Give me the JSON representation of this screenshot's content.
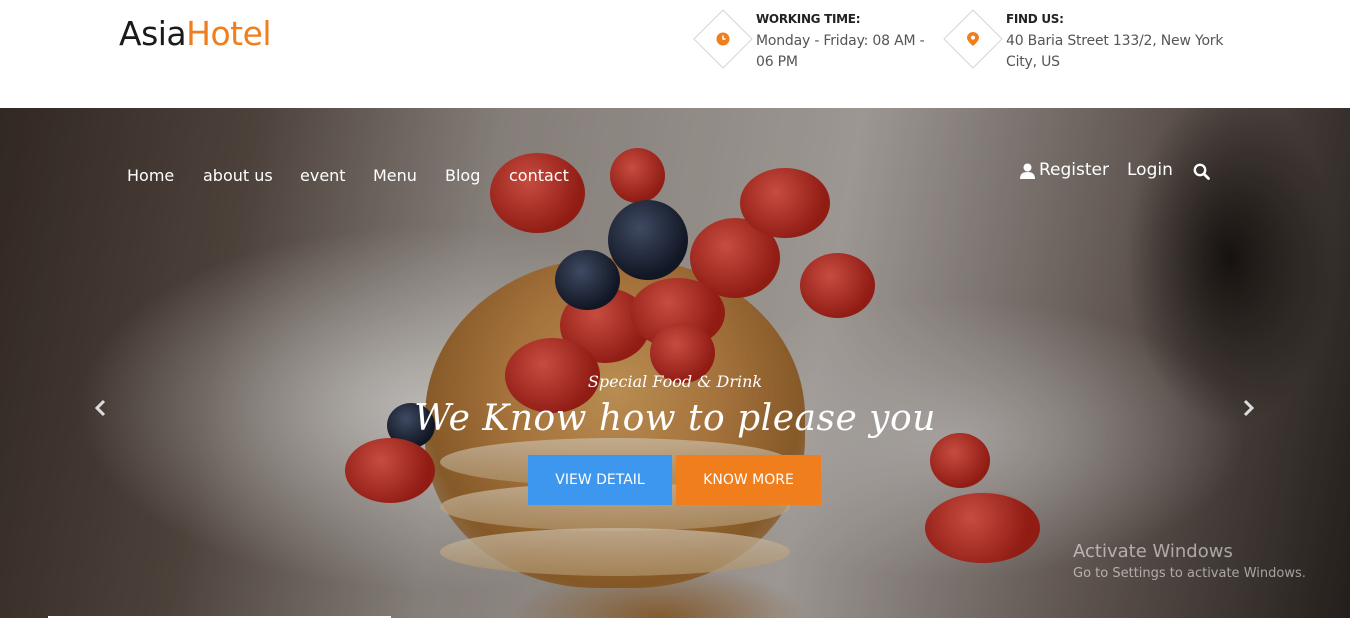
{
  "header": {
    "logo": {
      "part1": "Asia",
      "part2": "Hotel"
    },
    "working": {
      "title": "WORKING TIME:",
      "text": "Monday - Friday: 08 AM - 06 PM",
      "icon": "clock-icon"
    },
    "location": {
      "title": "FIND US:",
      "text": "40 Baria Street 133/2, New York City, US",
      "icon": "map-pin-icon"
    },
    "accent": "#f07e1d"
  },
  "nav": {
    "items": [
      "Home",
      "about us",
      "event",
      "Menu",
      "Blog",
      "contact"
    ],
    "register": "Register",
    "login": "Login"
  },
  "hero": {
    "subtitle": "Special Food & Drink",
    "headline": "We Know how to please you",
    "view_detail": "VIEW DETAIL",
    "know_more": "KNOW MORE",
    "view_detail_color": "#3d97ee",
    "know_more_color": "#f07e1d"
  },
  "watermark": {
    "title": "Activate Windows",
    "subtitle": "Go to Settings to activate Windows."
  }
}
